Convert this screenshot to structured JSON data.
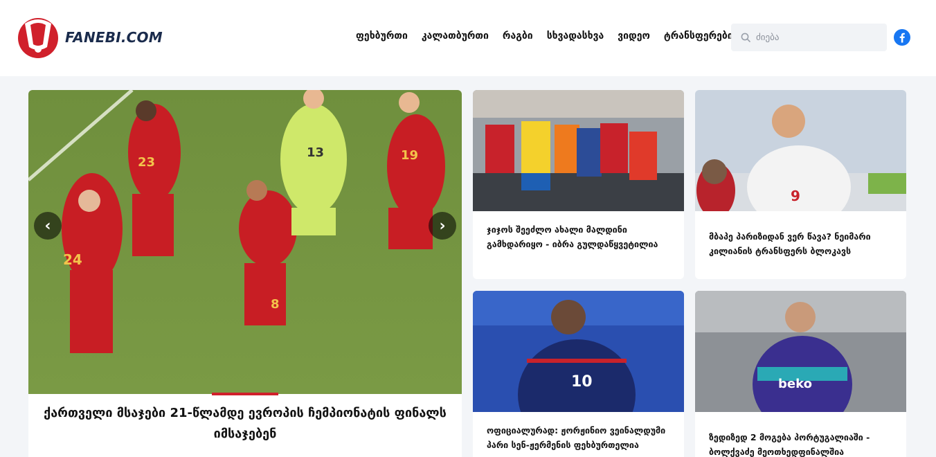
{
  "brand": {
    "name": "FANEBI.COM",
    "accent": "#d0202b"
  },
  "nav": {
    "items": [
      {
        "label": "ფეხბურთი"
      },
      {
        "label": "კალათბურთი"
      },
      {
        "label": "რაგბი"
      },
      {
        "label": "სხვადასხვა"
      },
      {
        "label": "ვიდეო"
      },
      {
        "label": "ტრანსფერები"
      }
    ]
  },
  "search": {
    "placeholder": "ძიება",
    "icon": "search-icon"
  },
  "social": {
    "icon": "facebook-icon",
    "color": "#1877f2"
  },
  "hero": {
    "title": "ქართველი მსაჯები 21-წლამდე ევროპის ჩემპიონატის ფინალს იმსაჯებენ",
    "prev_label": "‹",
    "next_label": "›"
  },
  "cards": [
    {
      "title": "ჯიჯოს შეეძლო ახალი მალდინი გამხდარიყო - იბრა გულდაწყვეტილია"
    },
    {
      "title": "მბაპე პარიზიდან ვერ წავა? ნეიმარი კილიანის ტრანსფერს ბლოკავს"
    },
    {
      "title": "ოფიციალურად: ჟორჟინიო ვეინალდუმი პარი სენ-ჟერმენის ფეხბურთელია"
    },
    {
      "title": "ზედიზედ 2 მოგება პორტუგალიაში - ბოლქვაძე მეოთხედფინალშია"
    }
  ]
}
